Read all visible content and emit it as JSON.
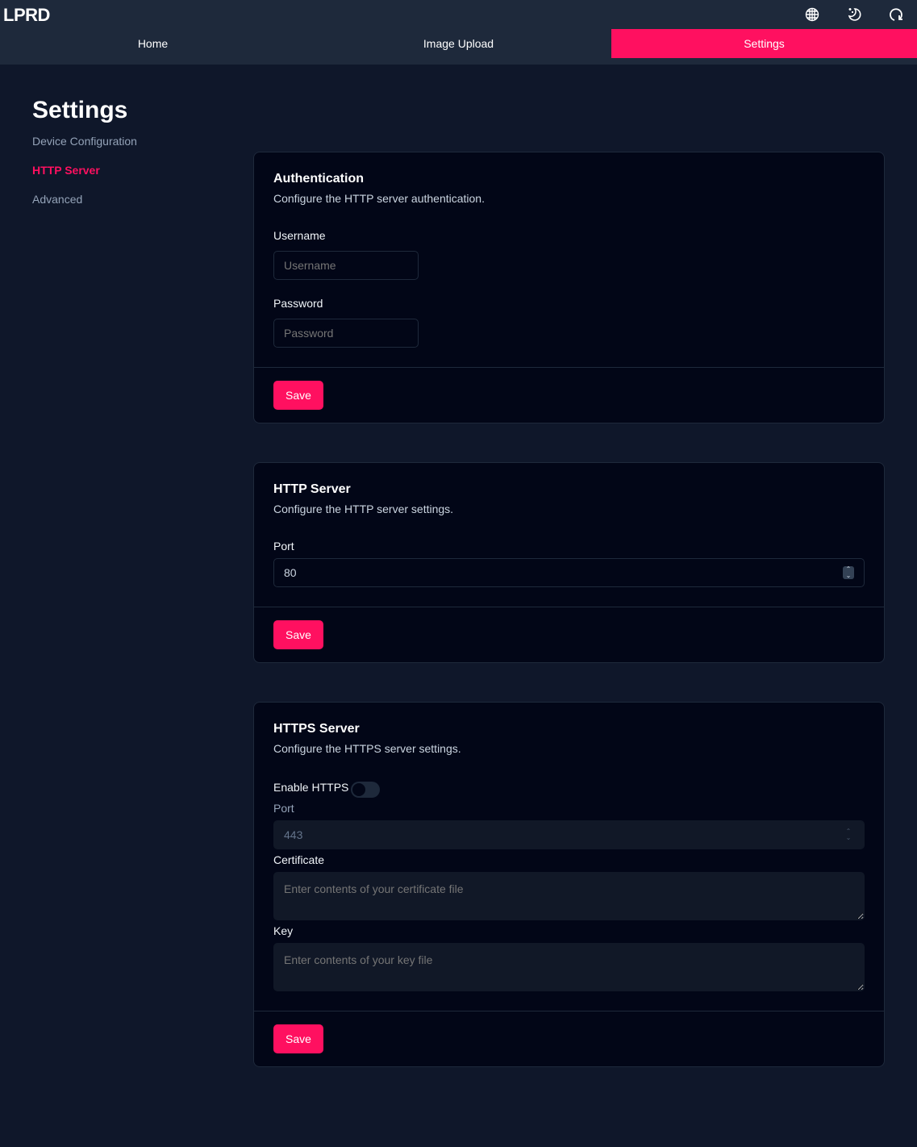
{
  "app": {
    "logo": "LPRD",
    "icons": [
      "globe-icon",
      "theme-moon-icon",
      "refresh-icon"
    ]
  },
  "nav": {
    "tabs": [
      {
        "label": "Home"
      },
      {
        "label": "Image Upload"
      },
      {
        "label": "Settings",
        "active": true
      }
    ]
  },
  "page": {
    "title": "Settings"
  },
  "sidebar": {
    "items": [
      {
        "label": "Device Configuration"
      },
      {
        "label": "HTTP Server",
        "active": true
      },
      {
        "label": "Advanced"
      }
    ]
  },
  "auth": {
    "title": "Authentication",
    "description": "Configure the HTTP server authentication.",
    "username_label": "Username",
    "username_placeholder": "Username",
    "password_label": "Password",
    "password_placeholder": "Password",
    "save": "Save"
  },
  "http": {
    "title": "HTTP Server",
    "description": "Configure the HTTP server settings.",
    "port_label": "Port",
    "port_value": "80",
    "save": "Save"
  },
  "https": {
    "title": "HTTPS Server",
    "description": "Configure the HTTPS server settings.",
    "enable_label": "Enable HTTPS",
    "enabled": false,
    "port_label": "Port",
    "port_value": "443",
    "cert_label": "Certificate",
    "cert_placeholder": "Enter contents of your certificate file",
    "key_label": "Key",
    "key_placeholder": "Enter contents of your key file",
    "save": "Save"
  },
  "colors": {
    "accent": "#ff1060",
    "header": "#1e293b",
    "background": "#0f172a",
    "card": "#020617"
  }
}
